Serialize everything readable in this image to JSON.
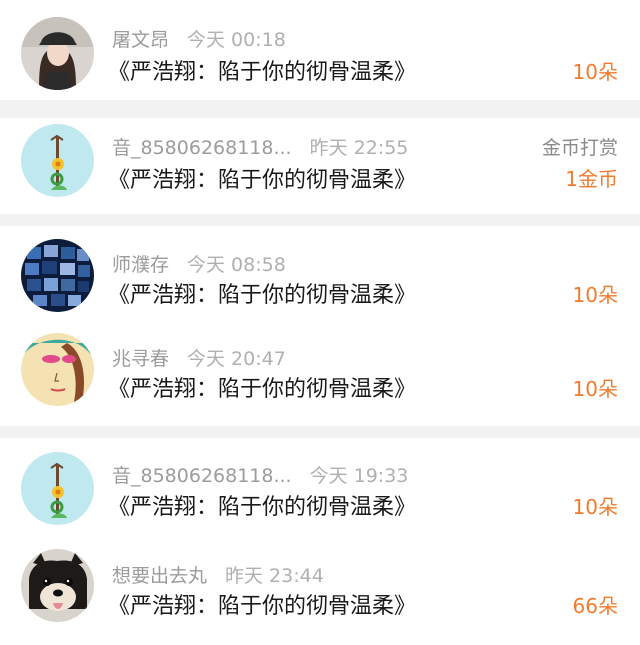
{
  "gifts": [
    {
      "user": "屠文昂",
      "time": "今天 00:18",
      "book": "《严浩翔：陷于你的彻骨温柔》",
      "amount": "10朵",
      "avatar": "woman-cap-avatar"
    },
    {
      "user": "音_85806268118...",
      "time": "昨天 22:55",
      "book": "《严浩翔：陷于你的彻骨温柔》",
      "type_label": "金币打赏",
      "amount": "1金币",
      "avatar": "flower-plant-avatar"
    },
    {
      "user": "师濮存",
      "time": "今天 08:58",
      "book": "《严浩翔：陷于你的彻骨温柔》",
      "amount": "10朵",
      "avatar": "collage-avatar"
    },
    {
      "user": "兆寻春",
      "time": "今天 20:47",
      "book": "《严浩翔：陷于你的彻骨温柔》",
      "amount": "10朵",
      "avatar": "painted-girl-avatar"
    },
    {
      "user": "音_85806268118...",
      "time": "今天 19:33",
      "book": "《严浩翔：陷于你的彻骨温柔》",
      "amount": "10朵",
      "avatar": "flower-plant-avatar"
    },
    {
      "user": "想要出去丸",
      "time": "昨天 23:44",
      "book": "《严浩翔：陷于你的彻骨温柔》",
      "amount": "66朵",
      "avatar": "dog-avatar"
    }
  ]
}
